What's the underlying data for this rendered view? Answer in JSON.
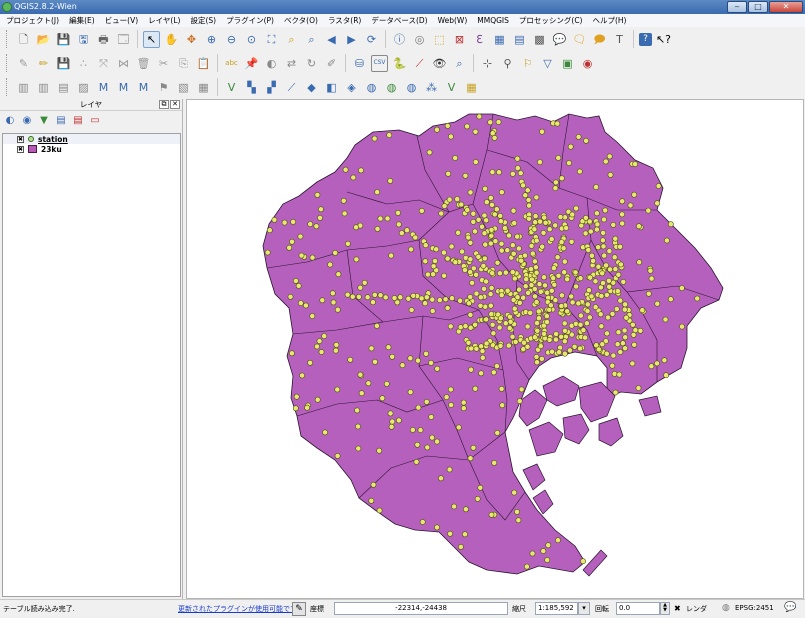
{
  "window": {
    "title": "QGIS2.8.2-Wien",
    "minimize": "‒",
    "maximize": "□",
    "close": "✕"
  },
  "menubar": {
    "items": [
      "プロジェクト(J)",
      "編集(E)",
      "ビュー(V)",
      "レイヤ(L)",
      "設定(S)",
      "プラグイン(P)",
      "ベクタ(O)",
      "ラスタ(R)",
      "データベース(D)",
      "Web(W)",
      "MMQGIS",
      "プロセッシング(C)",
      "ヘルプ(H)"
    ]
  },
  "toolbars": {
    "row1": [
      "new-project",
      "open-project",
      "save-project",
      "save-as",
      "print-composer",
      "composer-manager",
      "touch-zoom",
      "pan",
      "pan-to-selection",
      "zoom-in",
      "zoom-out",
      "zoom-actual",
      "zoom-full",
      "zoom-to-selection",
      "zoom-to-layer",
      "zoom-last",
      "zoom-next",
      "refresh",
      "identify",
      "map-tips",
      "select",
      "deselect",
      "field-calculator",
      "attribute-table",
      "statistics",
      "annotation",
      "text-annotation",
      "form-annotation",
      "label",
      "help",
      "whats-this"
    ],
    "row2": [
      "current-edits",
      "toggle-editing",
      "save-edits",
      "add-feature",
      "move-feature",
      "node-tool",
      "delete-selected",
      "cut-features",
      "copy-features",
      "paste-features",
      "label-tool",
      "pin-label",
      "show-hide-labels",
      "move-label",
      "rotate-label",
      "change-label",
      "db-manager",
      "csv-import",
      "python-console",
      "gps",
      "plugin-search",
      "identify-plus",
      "coordinate-capture",
      "georeferencer",
      "spatial-query",
      "layer-style",
      "openlayers"
    ],
    "row3": [
      "add-vector",
      "add-raster",
      "add-postgis",
      "add-spatialite",
      "add-mssql",
      "add-oracle",
      "add-wms",
      "add-wcs",
      "add-wfs",
      "add-delimited",
      "new-shapefile",
      "new-spatialite",
      "new-temp",
      "add-grass",
      "add-wms-plus",
      "add-virtual",
      "add-wfs-plus",
      "osm",
      "new-gpx",
      "edit-plus",
      "virtual-layer"
    ]
  },
  "layers_panel": {
    "title": "レイヤ",
    "layers": [
      {
        "name": "station",
        "checked": "✖",
        "symbol": "point"
      },
      {
        "name": "23ku",
        "checked": "✖",
        "symbol": "polygon"
      }
    ]
  },
  "map": {
    "polygon_fill": "#b660bd",
    "polygon_stroke": "#2a1530",
    "point_fill": "#e8e870",
    "point_stroke": "#4a4a10"
  },
  "statusbar": {
    "message": "テーブル読み込み完了.",
    "plugin_link": "更新されたプラグインが使用可能です",
    "coord_label": "座標",
    "coordinates": "-22314,-24438",
    "scale_label": "縮尺",
    "scale": "1:185,592",
    "rotation_label": "回転",
    "rotation": "0.0",
    "render_checkbox": "✖",
    "render_label": "レンダ",
    "crs": "EPSG:2451"
  }
}
